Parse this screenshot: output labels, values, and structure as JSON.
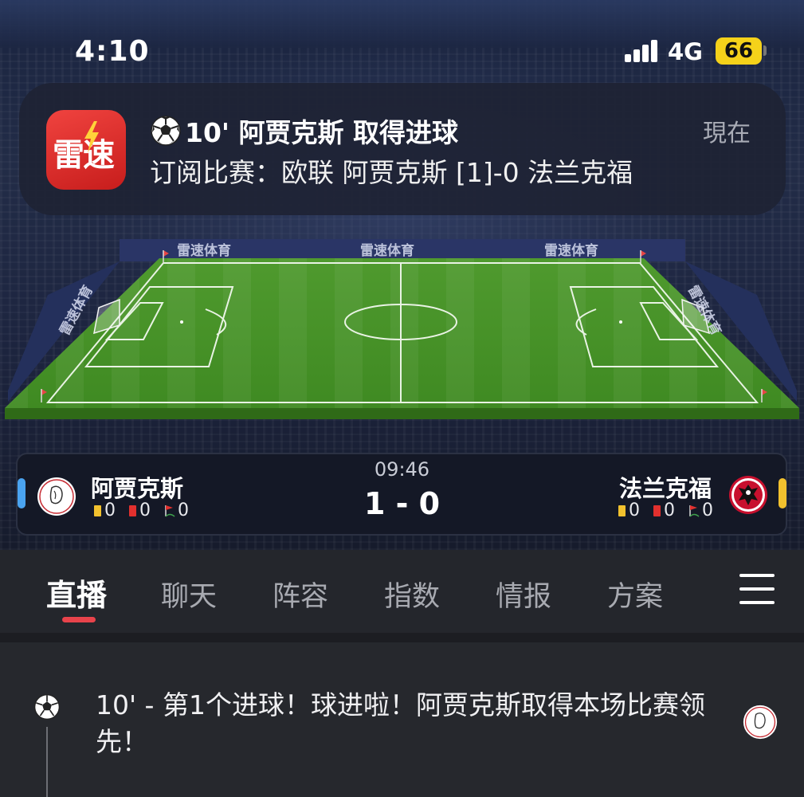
{
  "status_bar": {
    "time": "4:10",
    "network": "4G",
    "battery": "66",
    "colors": {
      "battery": "#f5d21a"
    }
  },
  "notification": {
    "app_icon_text": "雷速",
    "title": "10' 阿贾克斯 取得进球",
    "body": "订阅比赛：欧联 阿贾克斯 [1]-0 法兰克福",
    "time": "現在",
    "icon": "soccer-ball-icon",
    "colors": {
      "app_icon": "#e2302e"
    }
  },
  "pitch": {
    "boards": [
      "雷速体育",
      "雷速体育",
      "雷速体育",
      "雷速体育",
      "雷速体育"
    ]
  },
  "match": {
    "home": {
      "name": "阿贾克斯",
      "yellow_cards": "0",
      "red_cards": "0",
      "corners": "0",
      "color": "#4aa3f0"
    },
    "away": {
      "name": "法兰克福",
      "yellow_cards": "0",
      "red_cards": "0",
      "corners": "0",
      "color": "#f2c12e"
    },
    "clock": "09:46",
    "score": "1 - 0"
  },
  "tabs": [
    {
      "label": "直播",
      "active": true
    },
    {
      "label": "聊天",
      "active": false
    },
    {
      "label": "阵容",
      "active": false
    },
    {
      "label": "指数",
      "active": false
    },
    {
      "label": "情报",
      "active": false
    },
    {
      "label": "方案",
      "active": false
    }
  ],
  "tab_indicator_color": "#e8434b",
  "feed": {
    "items": [
      {
        "text": "10' - 第1个进球！球进啦！阿贾克斯取得本场比赛领先！",
        "icon": "soccer-ball-icon"
      }
    ]
  }
}
